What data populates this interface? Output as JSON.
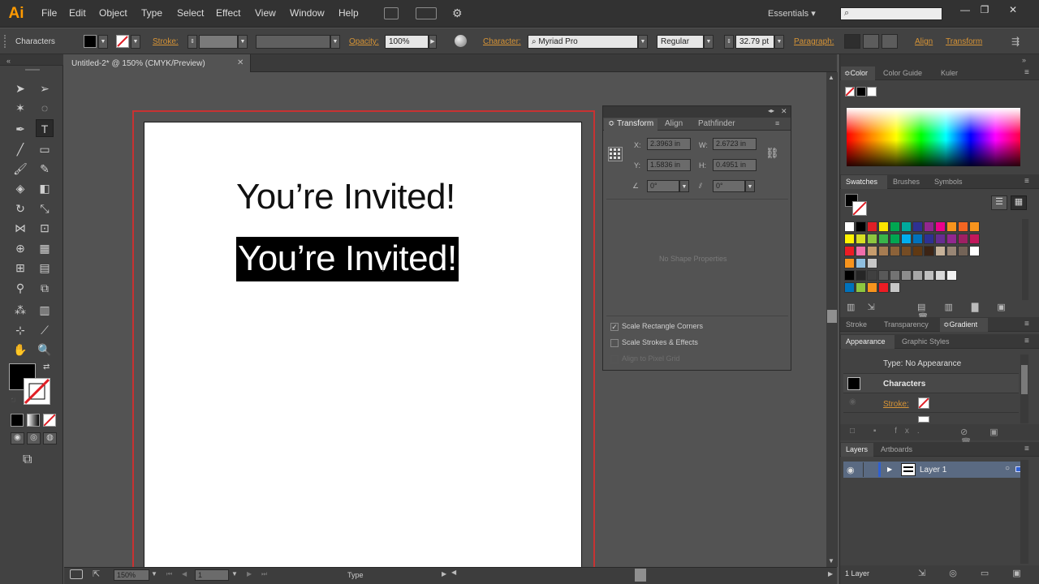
{
  "app": {
    "logo": "Ai"
  },
  "menu": [
    "File",
    "Edit",
    "Object",
    "Type",
    "Select",
    "Effect",
    "View",
    "Window",
    "Help"
  ],
  "workspace": "Essentials",
  "control_bar": {
    "mode_label": "Characters",
    "stroke_label": "Stroke:",
    "opacity_label": "Opacity:",
    "opacity_value": "100%",
    "character_label": "Character:",
    "font_family": "Myriad Pro",
    "font_style": "Regular",
    "font_size": "32.79 pt",
    "paragraph_label": "Paragraph:",
    "align_label": "Align",
    "transform_label": "Transform"
  },
  "document": {
    "tab_title": "Untitled-2* @ 150% (CMYK/Preview)"
  },
  "artboard": {
    "text_line_1": "You’re Invited!",
    "text_line_2": "You’re Invited!"
  },
  "transform_panel": {
    "tabs": [
      "Transform",
      "Align",
      "Pathfinder"
    ],
    "x_label": "X:",
    "x": "2.3963 in",
    "y_label": "Y:",
    "y": "1.5836 in",
    "w_label": "W:",
    "w": "2.6723 in",
    "h_label": "H:",
    "h": "0.4951 in",
    "rotate": "0°",
    "shear": "0°",
    "no_shape": "No Shape Properties",
    "scale_corners": "Scale Rectangle Corners",
    "scale_strokes": "Scale Strokes & Effects",
    "align_pixel": "Align to Pixel Grid"
  },
  "color_panel": {
    "tabs": [
      "Color",
      "Color Guide",
      "Kuler"
    ]
  },
  "swatches_panel": {
    "tabs": [
      "Swatches",
      "Brushes",
      "Symbols"
    ],
    "swatches": [
      [
        "#ffffff",
        "#000000",
        "#e01f26",
        "#ffe600",
        "#00a651",
        "#00a99d",
        "#2e3192",
        "#92278f",
        "#ec008c",
        "#f7941d",
        "#f26522",
        "#f7941d"
      ],
      [
        "#fff200",
        "#d7df23",
        "#8dc63f",
        "#39b54a",
        "#00a651",
        "#00aeef",
        "#0072bc",
        "#2e3192",
        "#662d91",
        "#92278f",
        "#9e1f63",
        "#c2185b"
      ],
      [
        "#ed1c24",
        "#f06eaa",
        "#c69c6d",
        "#a67c52",
        "#8c6239",
        "#754c24",
        "#603913",
        "#3c2415",
        "#c7b299",
        "#998675",
        "#736357",
        "#ffffff"
      ],
      [
        "#f7941d",
        "#8fbfe0",
        "#c7c7c7"
      ],
      [
        "#000000",
        "#262626",
        "#404040",
        "#595959",
        "#737373",
        "#8c8c8c",
        "#a6a6a6",
        "#bfbfbf",
        "#d9d9d9",
        "#f2f2f2"
      ],
      [
        "#0072bc",
        "#8dc63f",
        "#f7941d",
        "#ed1c24",
        "#c7c7c7"
      ]
    ]
  },
  "gradient_tabs": [
    "Stroke",
    "Transparency",
    "Gradient"
  ],
  "appearance_panel": {
    "tabs": [
      "Appearance",
      "Graphic Styles"
    ],
    "type_row": "Type: No Appearance",
    "characters_row": "Characters",
    "stroke_row": "Stroke:"
  },
  "layers_panel": {
    "tabs": [
      "Layers",
      "Artboards"
    ],
    "layer_name": "Layer 1",
    "count": "1 Layer"
  },
  "status_bar": {
    "zoom": "150%",
    "artboard_num": "1",
    "tool_name": "Type"
  }
}
